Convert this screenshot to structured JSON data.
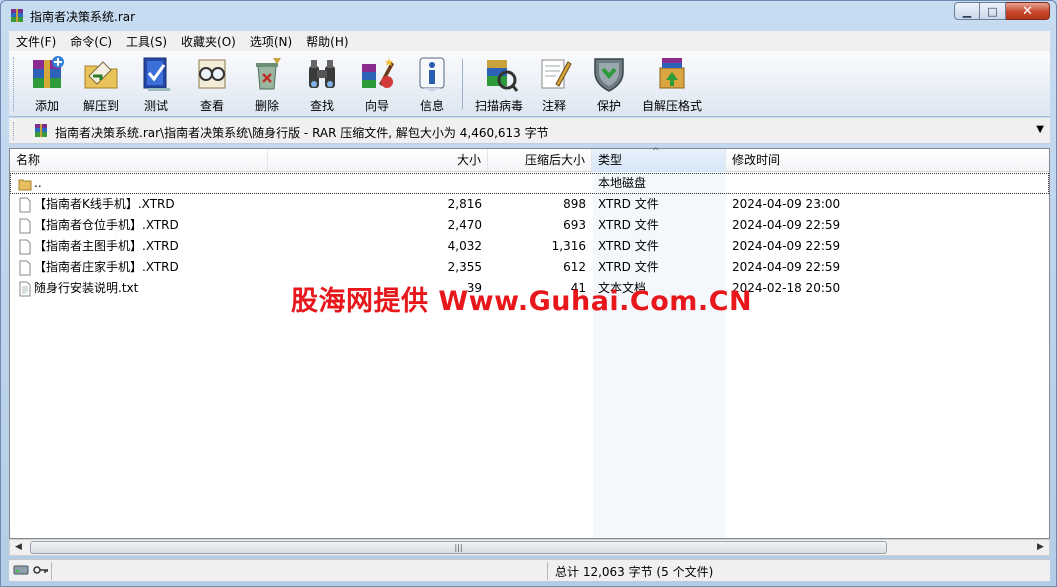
{
  "window": {
    "title": "指南者决策系统.rar",
    "minimize_glyph": "▁",
    "maximize_glyph": "□",
    "close_glyph": "✕"
  },
  "menu": [
    {
      "label": "文件(F)"
    },
    {
      "label": "命令(C)"
    },
    {
      "label": "工具(S)"
    },
    {
      "label": "收藏夹(O)"
    },
    {
      "label": "选项(N)"
    },
    {
      "label": "帮助(H)"
    }
  ],
  "toolbar": {
    "buttons": [
      {
        "label": "添加",
        "icon": "add-books-icon"
      },
      {
        "label": "解压到",
        "icon": "extract-folder-icon"
      },
      {
        "label": "测试",
        "icon": "test-check-icon"
      },
      {
        "label": "查看",
        "icon": "view-glasses-icon"
      },
      {
        "label": "删除",
        "icon": "delete-recycle-icon"
      },
      {
        "label": "查找",
        "icon": "find-binoculars-icon"
      },
      {
        "label": "向导",
        "icon": "wizard-icon"
      },
      {
        "label": "信息",
        "icon": "info-icon"
      },
      {
        "label": "扫描病毒",
        "icon": "virus-scan-icon"
      },
      {
        "label": "注释",
        "icon": "comment-pen-icon"
      },
      {
        "label": "保护",
        "icon": "protect-shield-icon"
      },
      {
        "label": "自解压格式",
        "icon": "sfx-box-icon"
      }
    ]
  },
  "path": {
    "text": "指南者决策系统.rar\\指南者决策系统\\随身行版 - RAR 压缩文件, 解包大小为 4,460,613 字节",
    "dropdown_glyph": "▼"
  },
  "columns": {
    "name": "名称",
    "size": "大小",
    "packed": "压缩后大小",
    "type": "类型",
    "modified": "修改时间",
    "sort_glyph": "^"
  },
  "files": [
    {
      "name": "..",
      "size": "",
      "packed": "",
      "type": "本地磁盘",
      "modified": "",
      "icon": "folder-up-icon"
    },
    {
      "name": "【指南者K线手机】.XTRD",
      "size": "2,816",
      "packed": "898",
      "type": "XTRD 文件",
      "modified": "2024-04-09 23:00",
      "icon": "file-icon"
    },
    {
      "name": "【指南者仓位手机】.XTRD",
      "size": "2,470",
      "packed": "693",
      "type": "XTRD 文件",
      "modified": "2024-04-09 22:59",
      "icon": "file-icon"
    },
    {
      "name": "【指南者主图手机】.XTRD",
      "size": "4,032",
      "packed": "1,316",
      "type": "XTRD 文件",
      "modified": "2024-04-09 22:59",
      "icon": "file-icon"
    },
    {
      "name": "【指南者庄家手机】.XTRD",
      "size": "2,355",
      "packed": "612",
      "type": "XTRD 文件",
      "modified": "2024-04-09 22:59",
      "icon": "file-icon"
    },
    {
      "name": "随身行安装说明.txt",
      "size": "39",
      "packed": "41",
      "type": "文本文档",
      "modified": "2024-02-18 20:50",
      "icon": "text-file-icon"
    }
  ],
  "watermark": "股海网提供 Www.Guhai.Com.CN",
  "scrollbar": {
    "left": "◀",
    "right": "▶",
    "grip": "|||"
  },
  "status": {
    "summary": "总计 12,063 字节 (5 个文件)"
  }
}
